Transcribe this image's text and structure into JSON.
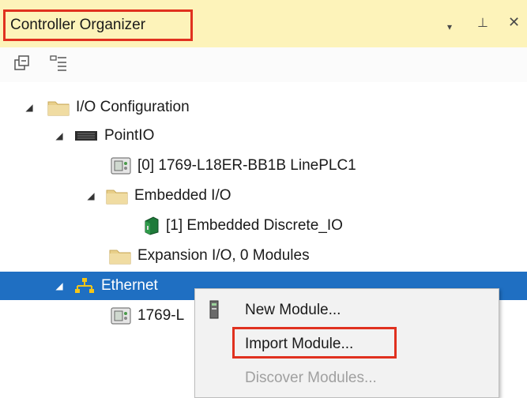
{
  "window": {
    "title": "Controller Organizer",
    "controls": [
      "▾",
      "⊥",
      "✕"
    ]
  },
  "toolbar": {
    "buttons": [
      "collapse-all-icon",
      "view-options-icon"
    ]
  },
  "tree": [
    {
      "label": "I/O Configuration",
      "icon": "folder-icon",
      "expanded": true
    },
    {
      "label": "PointIO",
      "icon": "backplane-icon",
      "expanded": true
    },
    {
      "label": "[0] 1769-L18ER-BB1B LinePLC1",
      "icon": "controller-module-icon"
    },
    {
      "label": "Embedded I/O",
      "icon": "folder-icon",
      "expanded": true
    },
    {
      "label": "[1] Embedded Discrete_IO",
      "icon": "io-module-icon"
    },
    {
      "label": "Expansion I/O, 0 Modules",
      "icon": "folder-icon"
    },
    {
      "label": "Ethernet",
      "icon": "network-icon",
      "expanded": true,
      "selected": true
    },
    {
      "label": "1769-L",
      "icon": "controller-module-icon"
    }
  ],
  "context_menu": {
    "items": [
      {
        "label": "New Module...",
        "icon": "module-icon",
        "enabled": true
      },
      {
        "label": "Import Module...",
        "enabled": true,
        "highlighted": true
      },
      {
        "label": "Discover Modules...",
        "enabled": false
      }
    ]
  },
  "colors": {
    "header_bg": "#fdf3ba",
    "highlight_border": "#e0311f",
    "selection_bg": "#1f6fc2"
  }
}
